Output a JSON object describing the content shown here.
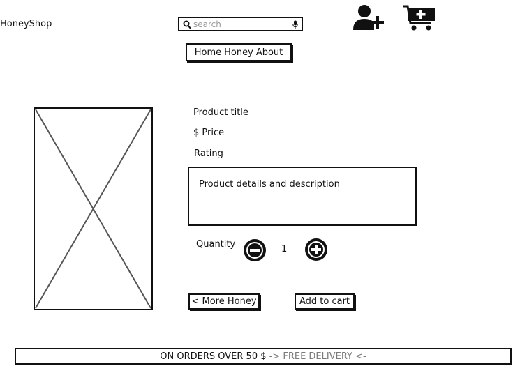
{
  "header": {
    "brand": "HoneyShop",
    "search": {
      "placeholder": "search",
      "icon": "search-icon",
      "mic_icon": "microphone-icon"
    },
    "nav": {
      "items": [
        "Home",
        "Honey",
        "About"
      ]
    },
    "icons": {
      "account": "add-user-icon",
      "cart": "add-to-cart-icon"
    }
  },
  "product": {
    "image_placeholder": "image-placeholder",
    "title": "Product title",
    "price": "$ Price",
    "rating": "Rating",
    "description": "Product details and description",
    "quantity_label": "Quantity",
    "quantity_value": "1",
    "minus_icon": "minus-circle-icon",
    "plus_icon": "plus-circle-icon"
  },
  "actions": {
    "more_label": "< More Honey",
    "add_to_cart_label": "Add to cart"
  },
  "banner": {
    "part1": "ON ORDERS OVER 50 $ ",
    "part2": "-> FREE DELIVERY <-"
  },
  "colors": {
    "ink": "#111111",
    "muted": "#7a7a7a"
  }
}
